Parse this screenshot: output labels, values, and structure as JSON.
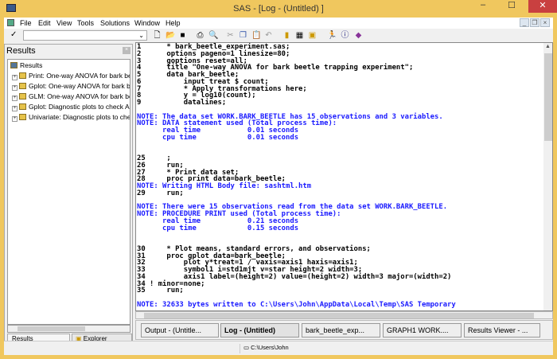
{
  "window": {
    "title": "SAS - [Log - (Untitled) ]",
    "minimize": "–",
    "maximize": "☐",
    "close": "✕"
  },
  "menu": [
    "File",
    "Edit",
    "View",
    "Tools",
    "Solutions",
    "Window",
    "Help"
  ],
  "toolbar": {
    "command_value": "",
    "icons": [
      "new-icon",
      "open-icon",
      "save-icon",
      "print-icon",
      "print-preview-icon",
      "cut-icon",
      "copy-icon",
      "paste-icon",
      "undo-icon",
      "new-library-icon",
      "explorer-icon",
      "libraries-icon",
      "run-icon",
      "help-icon",
      "book-icon"
    ]
  },
  "results": {
    "title": "Results",
    "root": "Results",
    "items": [
      "Print:  One-way ANOVA for bark beetle",
      "Gplot:  One-way ANOVA for bark beetle",
      "GLM:  One-way ANOVA for bark beetle",
      "Gplot:  Diagnostic plots to check ANOVA",
      "Univariate:  Diagnostic plots to check"
    ],
    "tabs": [
      "Results",
      "Explorer"
    ]
  },
  "log": {
    "lines": [
      {
        "t": "1      * bark_beetle_experiment.sas;",
        "k": "code"
      },
      {
        "t": "2      options pageno=1 linesize=80;",
        "k": "code"
      },
      {
        "t": "3      goptions reset=all;",
        "k": "code"
      },
      {
        "t": "4      title \"One-way ANOVA for bark beetle trapping experiment\";",
        "k": "code"
      },
      {
        "t": "5      data bark_beetle;",
        "k": "code"
      },
      {
        "t": "6          input treat $ count;",
        "k": "code"
      },
      {
        "t": "7          * Apply transformations here;",
        "k": "code"
      },
      {
        "t": "8          y = log10(count);",
        "k": "code"
      },
      {
        "t": "9          datalines;",
        "k": "code"
      },
      {
        "t": "",
        "k": "code"
      },
      {
        "t": "NOTE: The data set WORK.BARK_BEETLE has 15 observations and 3 variables.",
        "k": "note"
      },
      {
        "t": "NOTE: DATA statement used (Total process time):",
        "k": "note"
      },
      {
        "t": "      real time           0.01 seconds",
        "k": "note"
      },
      {
        "t": "      cpu time            0.01 seconds",
        "k": "note"
      },
      {
        "t": "",
        "k": "code"
      },
      {
        "t": "",
        "k": "code"
      },
      {
        "t": "25     ;",
        "k": "code"
      },
      {
        "t": "26     run;",
        "k": "code"
      },
      {
        "t": "27     * Print data set;",
        "k": "code"
      },
      {
        "t": "28     proc print data=bark_beetle;",
        "k": "code"
      },
      {
        "t": "NOTE: Writing HTML Body file: sashtml.htm",
        "k": "note"
      },
      {
        "t": "29     run;",
        "k": "code"
      },
      {
        "t": "",
        "k": "code"
      },
      {
        "t": "NOTE: There were 15 observations read from the data set WORK.BARK_BEETLE.",
        "k": "note"
      },
      {
        "t": "NOTE: PROCEDURE PRINT used (Total process time):",
        "k": "note"
      },
      {
        "t": "      real time           0.21 seconds",
        "k": "note"
      },
      {
        "t": "      cpu time            0.15 seconds",
        "k": "note"
      },
      {
        "t": "",
        "k": "code"
      },
      {
        "t": "",
        "k": "code"
      },
      {
        "t": "30     * Plot means, standard errors, and observations;",
        "k": "code"
      },
      {
        "t": "31     proc gplot data=bark_beetle;",
        "k": "code"
      },
      {
        "t": "32         plot y*treat=1 / vaxis=axis1 haxis=axis1;",
        "k": "code"
      },
      {
        "t": "33         symbol1 i=std1mjt v=star height=2 width=3;",
        "k": "code"
      },
      {
        "t": "34         axis1 label=(height=2) value=(height=2) width=3 major=(width=2)",
        "k": "code"
      },
      {
        "t": "34 ! minor=none;",
        "k": "code"
      },
      {
        "t": "35     run;",
        "k": "code"
      },
      {
        "t": "",
        "k": "code"
      },
      {
        "t": "NOTE: 32633 bytes written to C:\\Users\\John\\AppData\\Local\\Temp\\SAS Temporary",
        "k": "note"
      }
    ]
  },
  "tasks": [
    {
      "label": "Output - (Untitle...",
      "active": false
    },
    {
      "label": "Log - (Untitled)",
      "active": true
    },
    {
      "label": "bark_beetle_exp...",
      "active": false
    },
    {
      "label": "GRAPH1  WORK....",
      "active": false
    },
    {
      "label": "Results Viewer - ...",
      "active": false
    }
  ],
  "status": {
    "path": "C:\\Users\\John"
  },
  "colors": {
    "frame": "#f0c75e",
    "note": "#1a1aff",
    "close": "#c94040"
  }
}
